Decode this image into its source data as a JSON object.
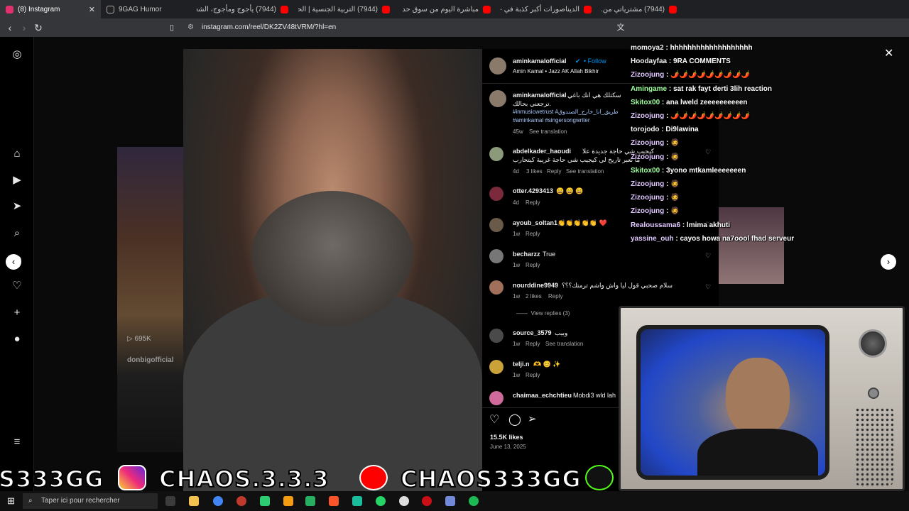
{
  "browser": {
    "tabs": [
      {
        "label": "(8) Instagram",
        "color": "#e1306c",
        "active": true
      },
      {
        "label": "9GAG Humor",
        "color": "#222222"
      },
      {
        "label": "(7944) يأجوج ومأجوج، الشعب الـ...",
        "color": "#ff0000"
      },
      {
        "label": "(7944) التربية الجنسية | الحلقة 2...",
        "color": "#ff0000"
      },
      {
        "label": "مباشرة اليوم من سوق حد السوا...",
        "color": "#ff0000"
      },
      {
        "label": "الديناصورات أكبر كذبة في حياتنا...",
        "color": "#ff0000"
      },
      {
        "label": "(7944) مشترياتي من...",
        "color": "#ff0000"
      }
    ],
    "url": "instagram.com/reel/DK2ZV48tVRM/?hl=en"
  },
  "post": {
    "author": "aminkamalofficial",
    "follow": "Follow",
    "audio": "Amin Kamal • Jazz AK Allah Bikhir",
    "caption_author": "aminkamalofficial",
    "caption_line1": "سكتلك هي انك باغي",
    "caption_line2": "ترجعني بحالك.",
    "caption_tags1": "#inmusicwetrust #طريق_انا_خارج_الصندوق",
    "caption_tags2": "#aminkamal #singersongwriter",
    "caption_time": "45w",
    "caption_translation": "See translation",
    "likes": "15.5K likes",
    "date": "June 13, 2025"
  },
  "comments": [
    {
      "user": "abdelkader_haoudi",
      "text": "كيجيب شي حاجة جديدة علا",
      "text2": "ما تعبر تاريخ لي كيجيب شي حاجة غريبة كيتحارب",
      "time": "4d",
      "likes": "3 likes",
      "reply": "Reply",
      "translation": "See translation",
      "avatar": "#8a9a7a"
    },
    {
      "user": "otter.4293413",
      "text": "😄 😄 😄",
      "time": "4d",
      "reply": "Reply",
      "avatar": "#7a2a3a"
    },
    {
      "user": "ayoub_soltan1",
      "text": "👏👏👏👏👏 ❤️",
      "time": "1w",
      "reply": "Reply",
      "avatar": "#6a5a4a"
    },
    {
      "user": "becharzz",
      "text": "True",
      "time": "1w",
      "reply": "Reply",
      "avatar": "#777777"
    },
    {
      "user": "nourddine9949",
      "text": "سلام صحبي قول ليا واش واشم ترمتك؟؟؟",
      "time": "1w",
      "likes": "2 likes",
      "reply": "Reply",
      "avatar": "#a0705a"
    },
    {
      "user": "source_3579",
      "text": "وبيب",
      "time": "1w",
      "reply": "Reply",
      "translation": "See translation",
      "avatar": "#4a4a4a"
    },
    {
      "user": "telji.n",
      "text": "🫶 😊 ✨",
      "time": "1w",
      "reply": "Reply",
      "avatar": "#c9a33a"
    },
    {
      "user": "chaimaa_echchtieu",
      "text": "Mobdi3 wld lah",
      "time": "",
      "reply": "",
      "avatar": "#d06a9a"
    }
  ],
  "view_replies": "View replies (3)",
  "bg_views": "695K",
  "bg_user": "donbigofficial",
  "chat": [
    {
      "user": "momoya2",
      "msg": "hhhhhhhhhhhhhhhhhhh",
      "color": "#f0f0f0"
    },
    {
      "user": "Hoodayfaa",
      "msg": "9RA COMMENTS",
      "color": "#f0f0f0"
    },
    {
      "user": "Zizoojung",
      "msg": "🌶️🌶️🌶️🌶️🌶️🌶️🌶️🌶️🌶️",
      "color": "#e0c8ff"
    },
    {
      "user": "Amingame",
      "msg": "sat rak fayt derti 3lih reaction",
      "color": "#9dff9d"
    },
    {
      "user": "Skitox00",
      "msg": "ana lweld zeeeeeeeeeen",
      "color": "#9dff9d"
    },
    {
      "user": "Zizoojung",
      "msg": "🌶️🌶️🌶️🌶️🌶️🌶️🌶️🌶️🌶️",
      "color": "#e0c8ff"
    },
    {
      "user": "torojodo",
      "msg": "Di9lawina",
      "color": "#f0f0f0"
    },
    {
      "user": "Zizoojung",
      "msg": "🧔",
      "color": "#e0c8ff"
    },
    {
      "user": "Zizoojung",
      "msg": "🧔",
      "color": "#e0c8ff"
    },
    {
      "user": "Skitox00",
      "msg": "3yono mtkamleeeeeeen",
      "color": "#9dff9d"
    },
    {
      "user": "Zizoojung",
      "msg": "🧔",
      "color": "#e0c8ff"
    },
    {
      "user": "Zizoojung",
      "msg": "🧔",
      "color": "#e0c8ff"
    },
    {
      "user": "Zizoojung",
      "msg": "🧔",
      "color": "#e0c8ff"
    },
    {
      "user": "Realoussama6",
      "msg": "lmima akhuti",
      "color": "#e0c8ff"
    },
    {
      "user": "yassine_ouh",
      "msg": "cayos howa na7oool fhad serveur",
      "color": "#e0c8ff"
    }
  ],
  "banner": {
    "left_handle": "S333GG",
    "ig_handle": "CHAOS.3.3.3",
    "yt_handle": "CHAOS333GG"
  },
  "taskbar": {
    "search_placeholder": "Taper ici pour rechercher"
  },
  "colors": {
    "accent": "#0095f6",
    "tv_screen": "#2247c7"
  }
}
